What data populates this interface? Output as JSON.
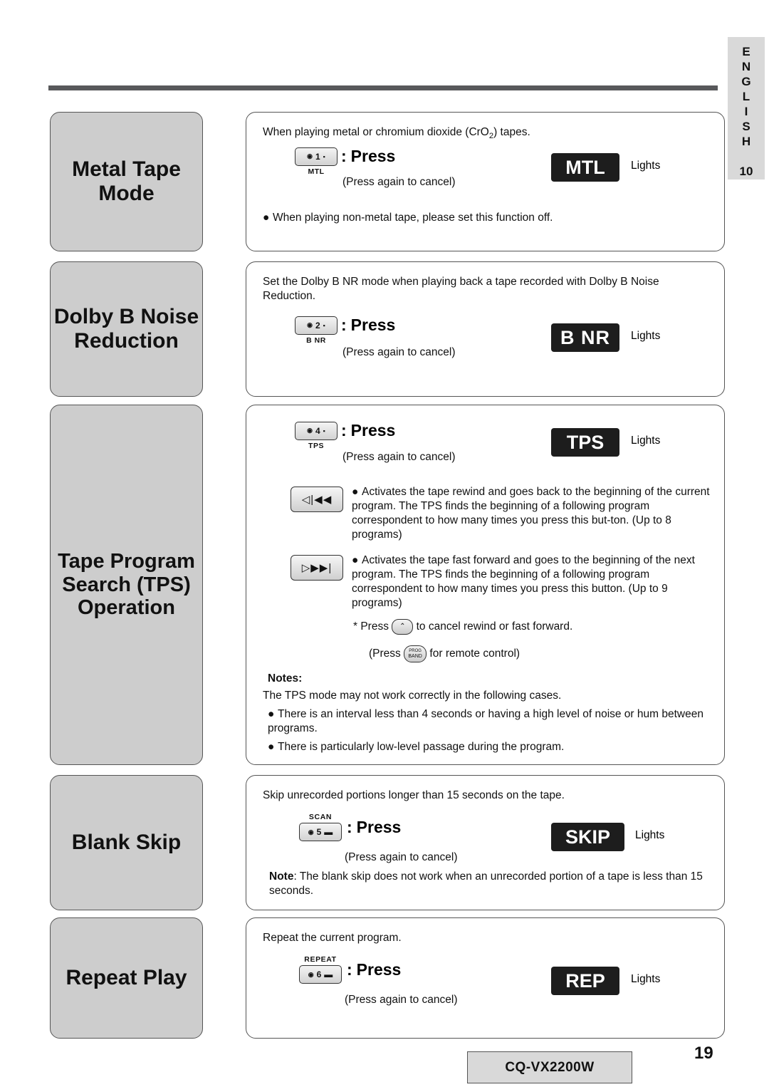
{
  "side_tab": {
    "letters": [
      "E",
      "N",
      "G",
      "L",
      "I",
      "S",
      "H"
    ],
    "number": "10"
  },
  "sections": [
    {
      "label": "Metal Tape\nMode",
      "label_lines": [
        "Metal Tape",
        "Mode"
      ],
      "intro": "When playing metal or chromium dioxide (CrO2) tapes.",
      "key": {
        "top": "",
        "num": "1",
        "cap": "MTL"
      },
      "press": "Press",
      "press_again": "(Press again to cancel)",
      "lcd": "MTL",
      "lights": "Lights",
      "note_bullet": "When playing non-metal tape, please set this function off."
    },
    {
      "label_lines": [
        "Dolby B Noise",
        "Reduction"
      ],
      "intro": "Set the Dolby B NR mode when playing back a tape recorded with Dolby B Noise Reduction.",
      "key": {
        "top": "",
        "num": "2",
        "cap": "B NR"
      },
      "press": "Press",
      "press_again": "(Press again to cancel)",
      "lcd": "B NR",
      "lights": "Lights"
    },
    {
      "label_lines": [
        "Tape Program",
        "Search (TPS)",
        "Operation"
      ],
      "key": {
        "top": "",
        "num": "4",
        "cap": "TPS"
      },
      "press": "Press",
      "press_again": "(Press again to cancel)",
      "lcd": "TPS",
      "lights": "Lights",
      "rewind_button": "◁|◀◀",
      "rewind_text": "Activates the tape rewind and goes back to the beginning of the current program.  The TPS finds the beginning of a following program correspondent to how many times you press this but-ton. (Up to 8 programs)",
      "forward_button": "▷▶▶|",
      "forward_text": "Activates the tape fast forward and goes to the beginning of the next program.  The TPS finds the beginning of a following program correspondent to how many times you press this button. (Up to 9 programs)",
      "cancel_line_pre": "*  Press",
      "cancel_line_post": "to cancel rewind or fast forward.",
      "remote_pre": "(Press",
      "remote_post": "for remote control)",
      "remote_btn_top": "PROG",
      "remote_btn_label": "BAND",
      "notes_title": "Notes:",
      "notes_lead": "The TPS mode may not work correctly in the following cases.",
      "notes": [
        "There is an interval less than 4 seconds or having a high level of noise or hum between programs.",
        "There is particularly low-level passage during the program."
      ]
    },
    {
      "label_lines": [
        "Blank Skip"
      ],
      "intro": "Skip unrecorded portions longer than 15 seconds on the tape.",
      "key": {
        "top": "SCAN",
        "num": "5",
        "cap": ""
      },
      "press": "Press",
      "press_again": "(Press again to cancel)",
      "lcd": "SKIP",
      "lights": "Lights",
      "note_label": "Note",
      "note_text": ": The blank skip does not work when an unrecorded portion of a tape is less than 15 seconds."
    },
    {
      "label_lines": [
        "Repeat Play"
      ],
      "intro": "Repeat the current program.",
      "key": {
        "top": "REPEAT",
        "num": "6",
        "cap": ""
      },
      "press": "Press",
      "press_again": "(Press again to cancel)",
      "lcd": "REP",
      "lights": "Lights"
    }
  ],
  "footer": {
    "model": "CQ-VX2200W",
    "page": "19"
  }
}
